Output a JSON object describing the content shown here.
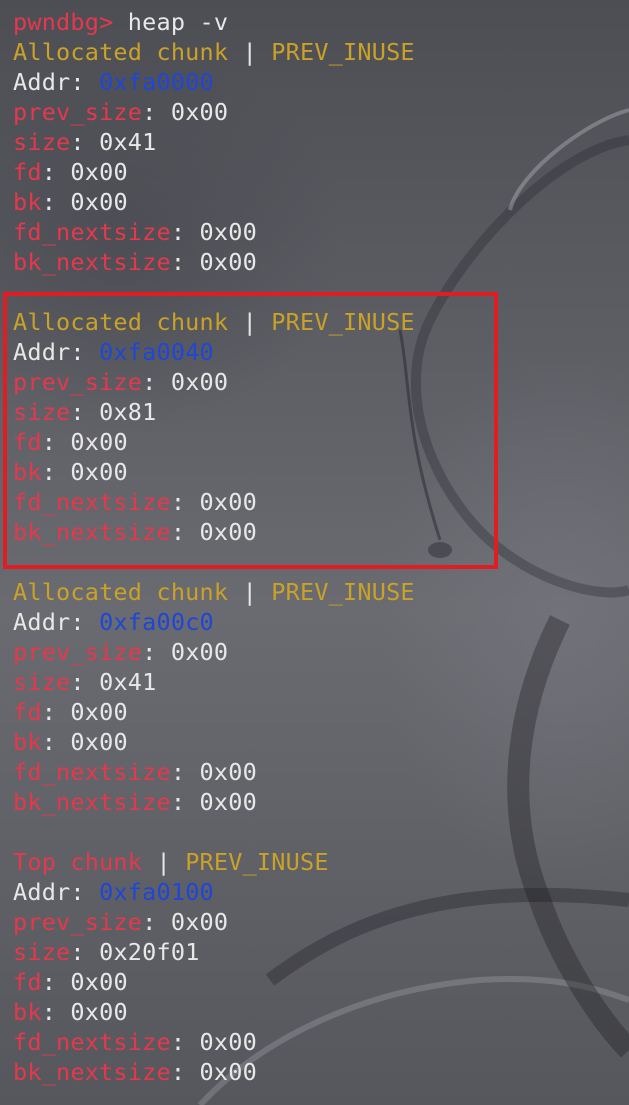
{
  "prompt": {
    "text": "pwndbg>",
    "command": " heap -v"
  },
  "chunks": [
    {
      "title": "Allocated chunk",
      "flag": "PREV_INUSE",
      "addr": "0xfa0000",
      "prev_size": "0x00",
      "size": "0x41",
      "fd": "0x00",
      "bk": "0x00",
      "fd_nextsize": "0x00",
      "bk_nextsize": "0x00"
    },
    {
      "title": "Allocated chunk",
      "flag": "PREV_INUSE",
      "addr": "0xfa0040",
      "prev_size": "0x00",
      "size": "0x81",
      "fd": "0x00",
      "bk": "0x00",
      "fd_nextsize": "0x00",
      "bk_nextsize": "0x00"
    },
    {
      "title": "Allocated chunk",
      "flag": "PREV_INUSE",
      "addr": "0xfa00c0",
      "prev_size": "0x00",
      "size": "0x41",
      "fd": "0x00",
      "bk": "0x00",
      "fd_nextsize": "0x00",
      "bk_nextsize": "0x00"
    },
    {
      "title": "Top chunk",
      "flag": "PREV_INUSE",
      "addr": "0xfa0100",
      "prev_size": "0x00",
      "size": "0x20f01",
      "fd": "0x00",
      "bk": "0x00",
      "fd_nextsize": "0x00",
      "bk_nextsize": "0x00"
    }
  ],
  "field_labels": {
    "addr": "Addr",
    "prev_size": "prev_size",
    "size": "size",
    "fd": "fd",
    "bk": "bk",
    "fd_nextsize": "fd_nextsize",
    "bk_nextsize": "bk_nextsize",
    "separator": ": ",
    "pipe": " | "
  },
  "colors": {
    "prompt": "#e5384c",
    "allocated_title": "#c9a227",
    "top_title": "#e5384c",
    "flag": "#c9a227",
    "field_name": "#e5384c",
    "address": "#1e46d8",
    "value": "#e8e8e8",
    "highlight_border": "#e11d24"
  }
}
